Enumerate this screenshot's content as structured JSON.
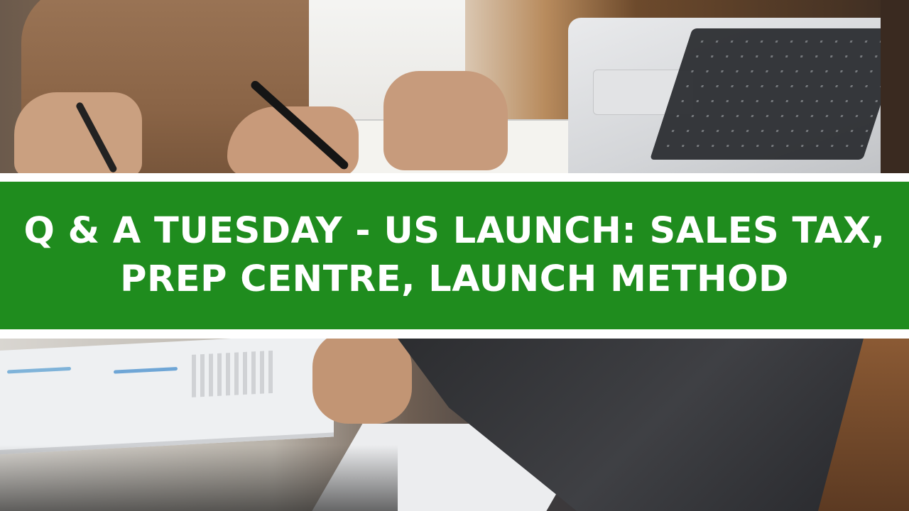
{
  "banner": {
    "line1": "Q & A TUESDAY - US LAUNCH: SALES TAX,",
    "line2": "PREP CENTRE, LAUNCH METHOD",
    "background_color": "#1f8c1e",
    "text_color": "#ffffff"
  },
  "separator_color": "#ffffff"
}
